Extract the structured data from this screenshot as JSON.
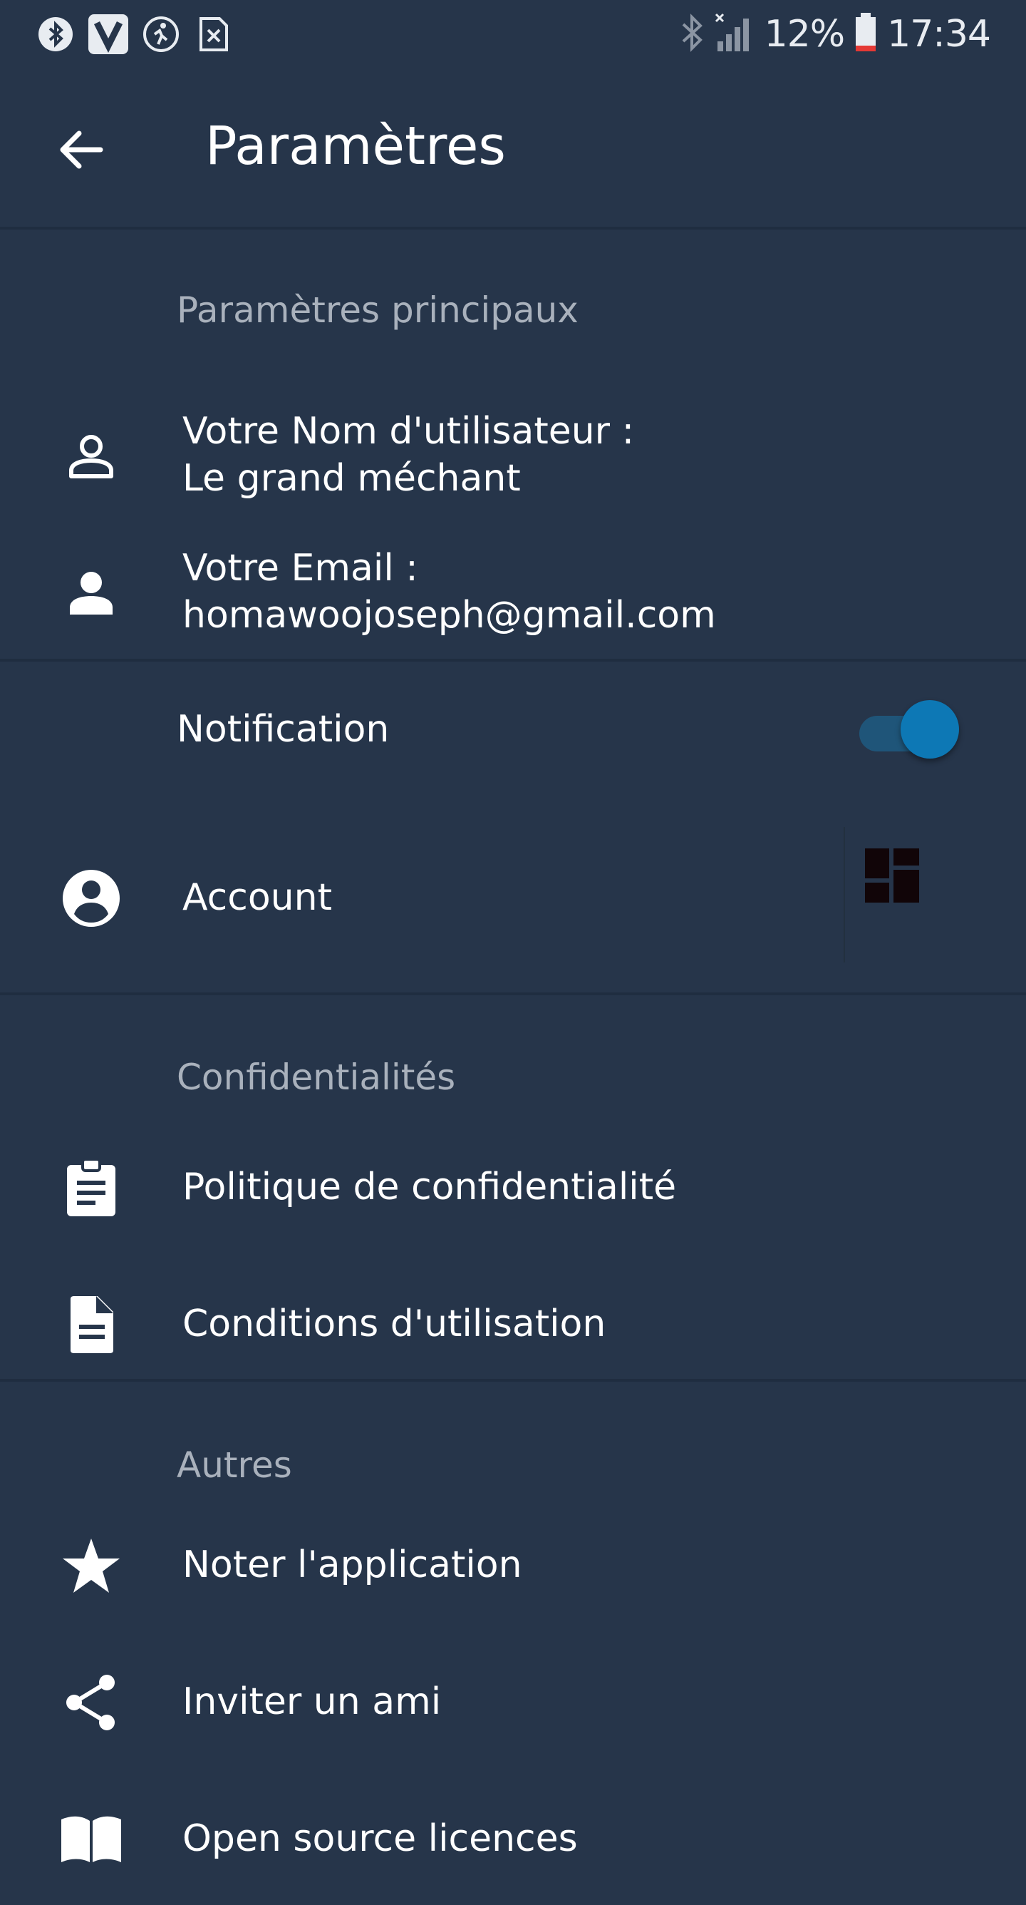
{
  "status_bar": {
    "battery": "12%",
    "time": "17:34",
    "icons_left": [
      "bluetooth-circle-icon",
      "v-app-icon",
      "activity-icon",
      "sim-x-icon"
    ],
    "icons_right": [
      "bluetooth-icon",
      "signal-icon",
      "battery-icon"
    ]
  },
  "header": {
    "title": "Paramètres"
  },
  "sections": {
    "main": {
      "title": "Paramètres principaux",
      "username_label": "Votre Nom d'utilisateur :",
      "username_value": "Le grand méchant",
      "email_label": "Votre Email :",
      "email_value": "homawoojoseph@gmail.com",
      "notification_label": "Notification",
      "notification_on": true,
      "account_label": "Account"
    },
    "privacy": {
      "title": "Confidentialités",
      "policy_label": "Politique de confidentialité",
      "terms_label": "Conditions d'utilisation"
    },
    "others": {
      "title": "Autres",
      "rate_label": "Noter l'application",
      "invite_label": "Inviter un ami",
      "licenses_label": "Open source licences"
    }
  },
  "colors": {
    "background": "#26354a",
    "accent": "#0d78b5",
    "section_title": "#a9b1bc"
  }
}
